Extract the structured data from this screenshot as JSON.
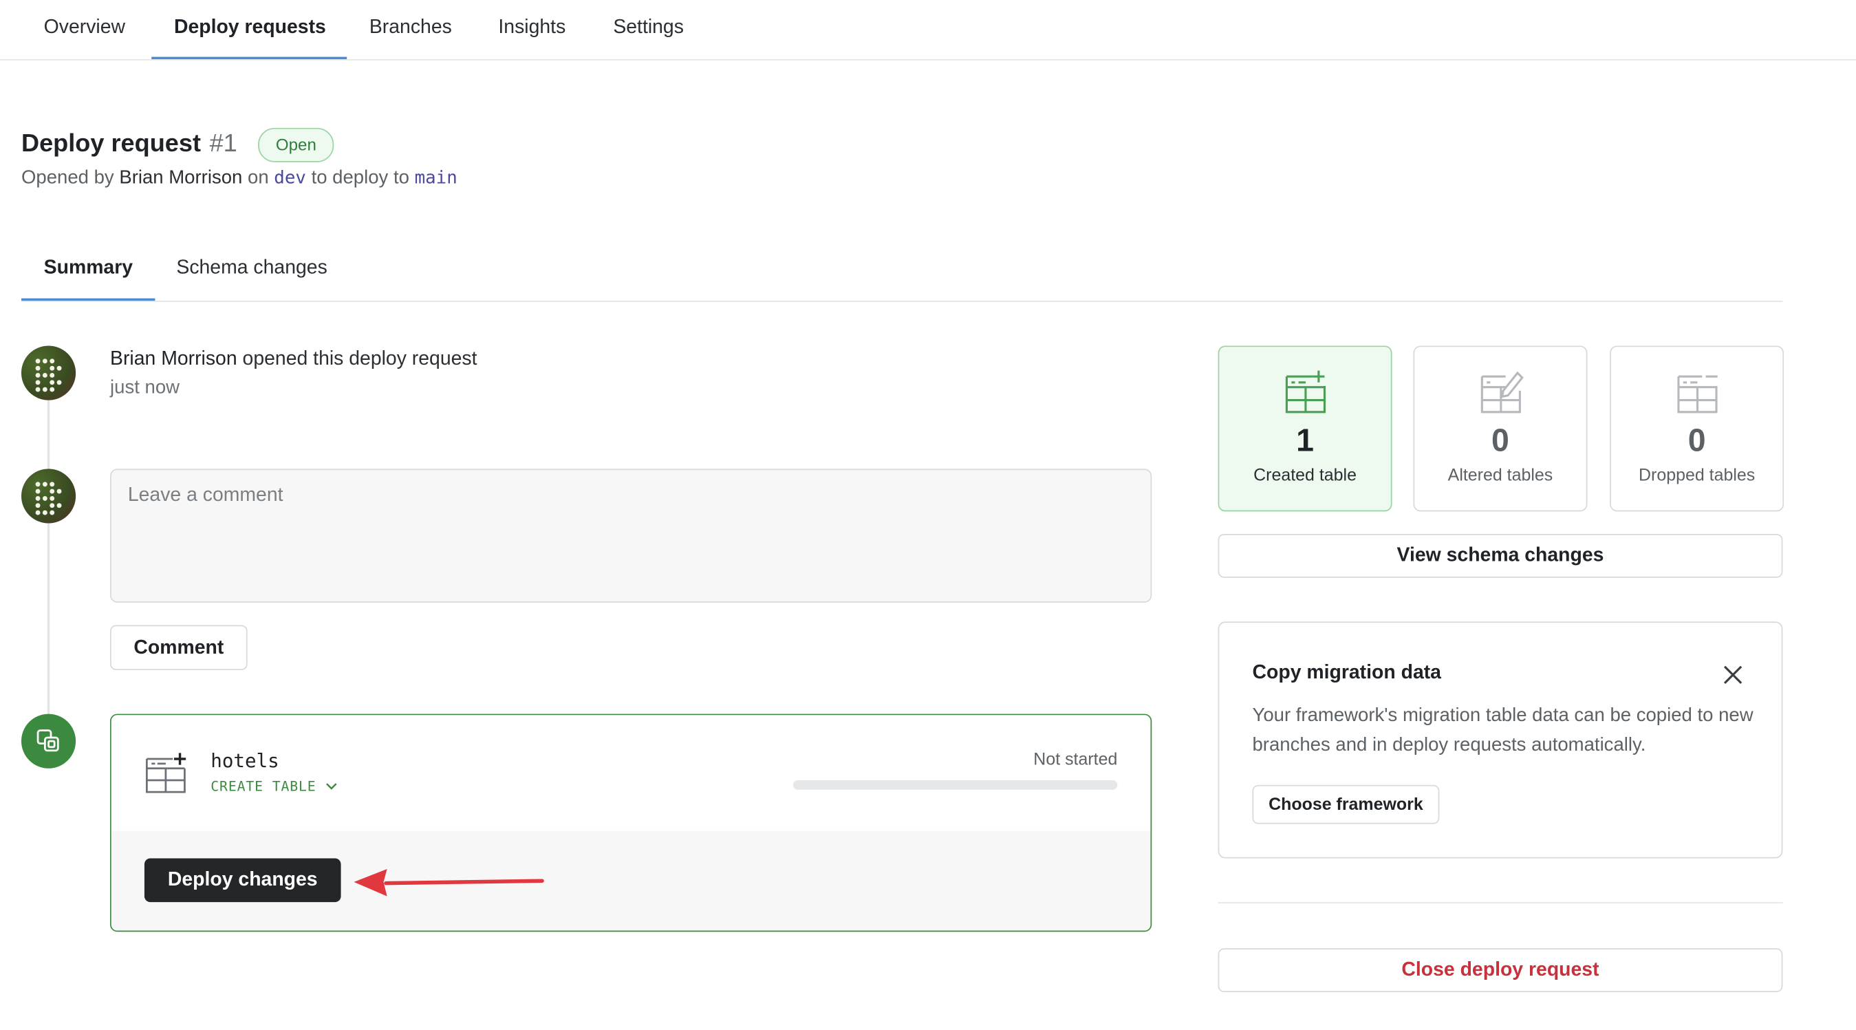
{
  "nav": {
    "tabs": [
      "Overview",
      "Deploy requests",
      "Branches",
      "Insights",
      "Settings"
    ],
    "active": "Deploy requests"
  },
  "header": {
    "title": "Deploy request",
    "number": "#1",
    "status": "Open",
    "opened_by_prefix": "Opened by",
    "author": "Brian Morrison",
    "on_text": "on",
    "source_branch": "dev",
    "to_deploy_text": "to deploy to",
    "target_branch": "main"
  },
  "subtabs": {
    "items": [
      "Summary",
      "Schema changes"
    ],
    "active": "Summary"
  },
  "timeline": {
    "event_author": "Brian Morrison",
    "event_action": "opened this deploy request",
    "event_time": "just now",
    "comment_placeholder": "Leave a comment",
    "comment_value": "",
    "comment_button": "Comment"
  },
  "deploy": {
    "table_name": "hotels",
    "operation": "CREATE TABLE",
    "status": "Not started",
    "progress_fraction": 0,
    "deploy_button": "Deploy changes"
  },
  "stats": {
    "created": {
      "count": "1",
      "label": "Created table"
    },
    "altered": {
      "count": "0",
      "label": "Altered tables"
    },
    "dropped": {
      "count": "0",
      "label": "Dropped tables"
    }
  },
  "view_schema_button": "View schema changes",
  "migration": {
    "title": "Copy migration data",
    "text": "Your framework's migration table data can be copied to new branches and in deploy requests automatically.",
    "button": "Choose framework"
  },
  "close_button": "Close deploy request",
  "colors": {
    "accent_blue": "#4a8bd4",
    "green": "#3b8a3f",
    "danger_red": "#c6313c",
    "annotation_arrow": "#e0383e"
  }
}
